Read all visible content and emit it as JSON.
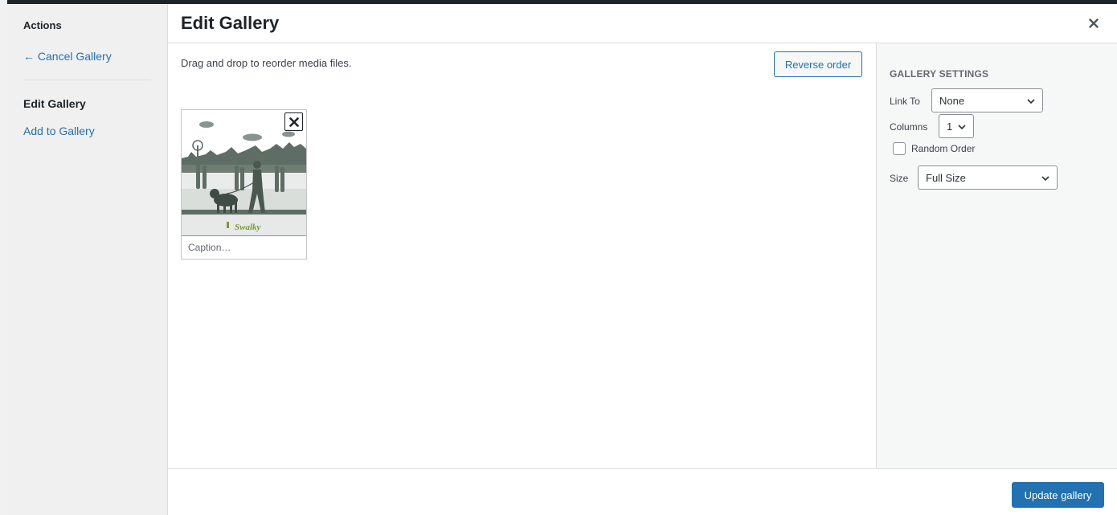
{
  "menu": {
    "heading": "Actions",
    "cancel_label": "← Cancel Gallery",
    "edit_label": "Edit Gallery",
    "add_label": "Add to Gallery"
  },
  "header": {
    "title": "Edit Gallery",
    "close_icon": "close-icon"
  },
  "content": {
    "instructions": "Drag and drop to reorder media files.",
    "reverse_label": "Reverse order",
    "attachments": [
      {
        "thumbnail_icon": "park-silhouette-image",
        "logo_text": "Swalky",
        "caption_placeholder": "Caption…",
        "caption_value": ""
      }
    ]
  },
  "settings": {
    "title": "GALLERY SETTINGS",
    "link_to_label": "Link To",
    "link_to_value": "None",
    "columns_label": "Columns",
    "columns_value": "1",
    "random_label": "Random Order",
    "random_checked": false,
    "size_label": "Size",
    "size_value": "Full Size"
  },
  "footer": {
    "update_label": "Update gallery"
  },
  "colors": {
    "accent": "#2271b1",
    "sidebar_bg": "#f6f7f7",
    "menu_bg": "#f0f0f1",
    "thumb_fill": "#5f6e64",
    "logo_green": "#7a9a3a"
  }
}
